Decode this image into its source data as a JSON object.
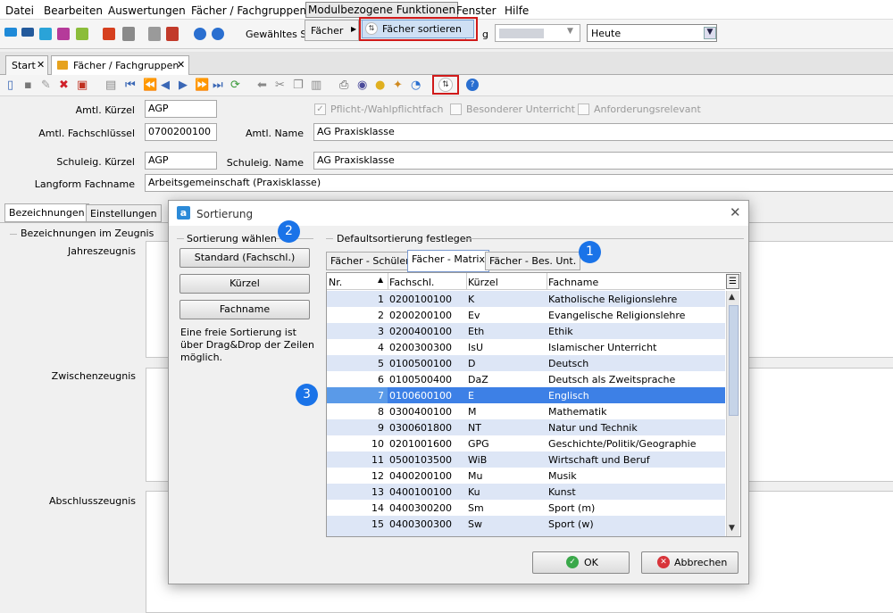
{
  "menu": {
    "items": [
      "Datei",
      "Bearbeiten",
      "Auswertungen",
      "Fächer / Fachgruppen",
      "Modulbezogene Funktionen",
      "Fenster",
      "Hilfe"
    ],
    "submenu_label": "Fächer",
    "submenu_item": "Fächer sortieren"
  },
  "toolbar": {
    "selected_label": "Gewähltes Sc",
    "partial_label": "g",
    "date_value": "Heute"
  },
  "tabs": {
    "start": "Start",
    "faecher": "Fächer / Fachgruppen"
  },
  "form": {
    "amtl_kuerzel_label": "Amtl. Kürzel",
    "amtl_kuerzel": "AGP",
    "amtl_fachschluessel_label": "Amtl. Fachschlüssel",
    "amtl_fachschluessel": "0700200100",
    "amtl_name_label": "Amtl. Name",
    "amtl_name": "AG Praxisklasse",
    "schuleig_kuerzel_label": "Schuleig. Kürzel",
    "schuleig_kuerzel": "AGP",
    "schuleig_name_label": "Schuleig. Name",
    "schuleig_name": "AG Praxisklasse",
    "langform_label": "Langform Fachname",
    "langform": "Arbeitsgemeinschaft (Praxisklasse)",
    "chk_pflicht": "Pflicht-/Wahlpflichtfach",
    "chk_besonderer": "Besonderer Unterricht",
    "chk_anforderung": "Anforderungsrelevant",
    "subtab_bezeichnungen": "Bezeichnungen",
    "subtab_einstellungen": "Einstellungen",
    "section_zeugnis": "Bezeichnungen im Zeugnis",
    "jahreszeugnis": "Jahreszeugnis",
    "zwischenzeugnis": "Zwischenzeugnis",
    "abschlusszeugnis": "Abschlusszeugnis"
  },
  "dialog": {
    "title": "Sortierung",
    "left_section": "Sortierung wählen",
    "btn_standard": "Standard (Fachschl.)",
    "btn_kuerzel": "Kürzel",
    "btn_fachname": "Fachname",
    "hint": "Eine freie Sortierung ist über Drag&Drop der Zeilen möglich.",
    "right_section": "Defaultsortierung festlegen",
    "tab_schueler": "Fächer - Schüler",
    "tab_matrix": "Fächer - Matrix",
    "tab_besunt": "Fächer - Bes. Unt.",
    "badge1": "1",
    "badge2": "2",
    "badge3": "3",
    "ok": "OK",
    "cancel": "Abbrechen"
  },
  "grid": {
    "columns": [
      "Nr.",
      "Fachschl.",
      "Kürzel",
      "Fachname"
    ],
    "rows": [
      {
        "nr": "1",
        "key": "0200100100",
        "kuerzel": "K",
        "name": "Katholische Religionslehre"
      },
      {
        "nr": "2",
        "key": "0200200100",
        "kuerzel": "Ev",
        "name": "Evangelische Religionslehre"
      },
      {
        "nr": "3",
        "key": "0200400100",
        "kuerzel": "Eth",
        "name": "Ethik"
      },
      {
        "nr": "4",
        "key": "0200300300",
        "kuerzel": "IsU",
        "name": "Islamischer Unterricht"
      },
      {
        "nr": "5",
        "key": "0100500100",
        "kuerzel": "D",
        "name": "Deutsch"
      },
      {
        "nr": "6",
        "key": "0100500400",
        "kuerzel": "DaZ",
        "name": "Deutsch als Zweitsprache"
      },
      {
        "nr": "7",
        "key": "0100600100",
        "kuerzel": "E",
        "name": "Englisch"
      },
      {
        "nr": "8",
        "key": "0300400100",
        "kuerzel": "M",
        "name": "Mathematik"
      },
      {
        "nr": "9",
        "key": "0300601800",
        "kuerzel": "NT",
        "name": "Natur und Technik"
      },
      {
        "nr": "10",
        "key": "0201001600",
        "kuerzel": "GPG",
        "name": "Geschichte/Politik/Geographie"
      },
      {
        "nr": "11",
        "key": "0500103500",
        "kuerzel": "WiB",
        "name": "Wirtschaft und Beruf"
      },
      {
        "nr": "12",
        "key": "0400200100",
        "kuerzel": "Mu",
        "name": "Musik"
      },
      {
        "nr": "13",
        "key": "0400100100",
        "kuerzel": "Ku",
        "name": "Kunst"
      },
      {
        "nr": "14",
        "key": "0400300200",
        "kuerzel": "Sm",
        "name": "Sport (m)"
      },
      {
        "nr": "15",
        "key": "0400300300",
        "kuerzel": "Sw",
        "name": "Sport (w)"
      }
    ],
    "selected_row": 7
  }
}
